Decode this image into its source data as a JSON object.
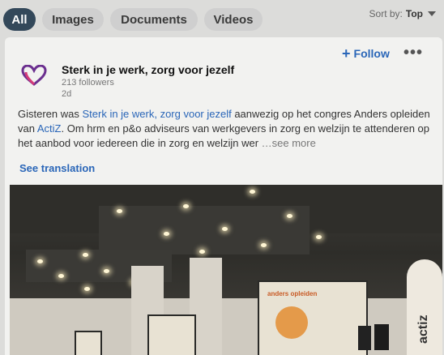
{
  "filters": {
    "chips": [
      "All",
      "Images",
      "Documents",
      "Videos"
    ],
    "active": "All",
    "sort_label": "Sort by:",
    "sort_value": "Top"
  },
  "post": {
    "author": "Sterk in je werk, zorg voor jezelf",
    "followers": "213 followers",
    "age": "2d",
    "follow_label": "Follow",
    "more_menu": "•••",
    "text_part1": "Gisteren was ",
    "text_link1": "Sterk in je werk, zorg voor jezelf",
    "text_part2": " aanwezig op het congres Anders opleiden van ",
    "text_link2": "ActiZ",
    "text_part3": ". Om hrm en p&o adviseurs van werkgevers in zorg en welzijn te attenderen op het aanbod voor iedereen die in zorg en welzijn wer",
    "see_more": "…see more",
    "see_translation": "See translation"
  },
  "image": {
    "screen_title": "anders opleiden",
    "banner_text": "actiz"
  },
  "colors": {
    "accent": "#2a66b8",
    "chip_active": "#33485a",
    "logo_purple": "#6b2f8f",
    "logo_pink": "#d43a78"
  },
  "icons": {
    "logo": "heart-logo-icon",
    "more": "more-horizontal-icon",
    "sort": "chevron-down-icon"
  }
}
